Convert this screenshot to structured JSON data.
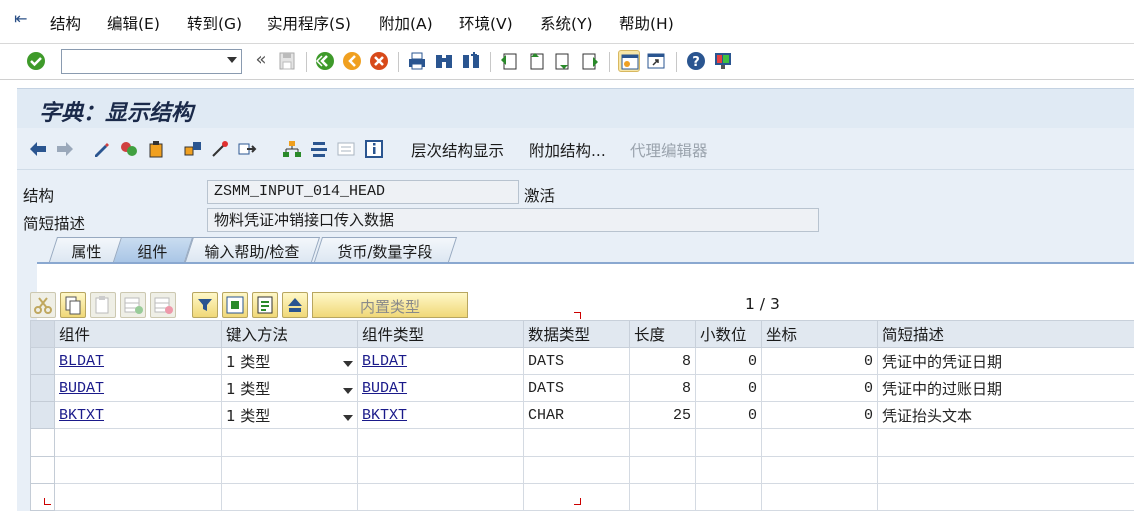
{
  "menu": {
    "items": [
      "结构",
      "编辑(E)",
      "转到(G)",
      "实用程序(S)",
      "附加(A)",
      "环境(V)",
      "系统(Y)",
      "帮助(H)"
    ]
  },
  "toolbar": {
    "command_field_value": "",
    "icons": [
      "enter-check-icon",
      "back-double-arrow-icon",
      "save-icon",
      "back-icon",
      "exit-icon",
      "cancel-icon",
      "print-icon",
      "find-icon",
      "find-next-icon",
      "first-page-icon",
      "previous-page-icon",
      "next-page-icon",
      "last-page-icon",
      "create-session-icon",
      "shortcut-icon",
      "help-icon",
      "layout-icon"
    ]
  },
  "title": "字典：显示结构",
  "app_toolbar": {
    "hierarchy_label": "层次结构显示",
    "append_label": "附加结构...",
    "proxy_editor_label": "代理编辑器"
  },
  "header": {
    "struct_label": "结构",
    "struct_value": "ZSMM_INPUT_014_HEAD",
    "status": "激活",
    "desc_label": "简短描述",
    "desc_value": "物料凭证冲销接口传入数据"
  },
  "tabs": [
    "属性",
    "组件",
    "输入帮助/检查",
    "货币/数量字段"
  ],
  "selected_tab": "组件",
  "panel": {
    "builtin_type_label": "内置类型",
    "pager": "1 / 3"
  },
  "grid": {
    "columns": [
      "组件",
      "键入方法",
      "组件类型",
      "数据类型",
      "长度",
      "小数位",
      "坐标",
      "简短描述"
    ],
    "rows": [
      {
        "component": "BLDAT",
        "method": "1 类型",
        "type": "BLDAT",
        "dtype": "DATS",
        "length": "8",
        "decimals": "0",
        "coord": "0",
        "desc": "凭证中的凭证日期"
      },
      {
        "component": "BUDAT",
        "method": "1 类型",
        "type": "BUDAT",
        "dtype": "DATS",
        "length": "8",
        "decimals": "0",
        "coord": "0",
        "desc": "凭证中的过账日期"
      },
      {
        "component": "BKTXT",
        "method": "1 类型",
        "type": "BKTXT",
        "dtype": "CHAR",
        "length": "25",
        "decimals": "0",
        "coord": "0",
        "desc": "凭证抬头文本"
      }
    ]
  },
  "colors": {
    "title_bg": "#e0eaf4",
    "body_bg": "#e8eff7",
    "tab_selected": "#aac6e6",
    "link": "#1a1a8a"
  }
}
